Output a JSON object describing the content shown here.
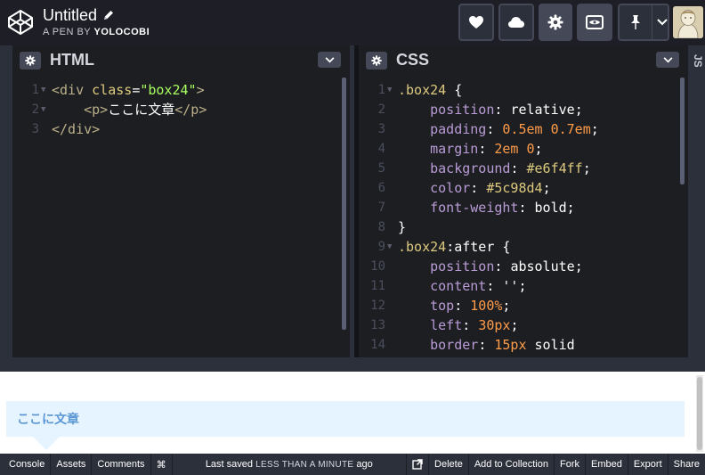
{
  "app": {
    "pen_title": "Untitled",
    "byline_prefix": "A PEN BY",
    "author": "YOLOCOBI"
  },
  "editors": {
    "html": {
      "title": "HTML",
      "lines": [
        {
          "num": "1",
          "fold": true
        },
        {
          "num": "2",
          "fold": true
        },
        {
          "num": "3",
          "fold": false
        }
      ],
      "code": {
        "l1_open": "<div",
        "l1_attr": " class",
        "l1_eq": "=",
        "l1_str": "\"box24\"",
        "l1_close": ">",
        "l2_indent": "    ",
        "l2_p_open": "<p>",
        "l2_text": "ここに文章",
        "l2_p_close": "</p>",
        "l3_close": "</div>"
      }
    },
    "css": {
      "title": "CSS",
      "line_numbers": [
        "1",
        "2",
        "3",
        "4",
        "5",
        "6",
        "7",
        "8",
        "9",
        "10",
        "11",
        "12",
        "13",
        "14"
      ],
      "code": {
        "l1_sel": ".box24",
        "l1_brace": " {",
        "l2_prop": "position",
        "l2_val": "relative",
        "l3_prop": "padding",
        "l3_val1": "0.5em",
        "l3_val2": "0.7em",
        "l4_prop": "margin",
        "l4_val1": "2em",
        "l4_val2": "0",
        "l5_prop": "background",
        "l5_val": "#e6f4ff",
        "l6_prop": "color",
        "l6_val": "#5c98d4",
        "l7_prop": "font-weight",
        "l7_val": "bold",
        "l8_brace": "}",
        "l9_sel": ".box24",
        "l9_pseudo": ":after",
        "l9_brace": " {",
        "l10_prop": "position",
        "l10_val": "absolute",
        "l11_prop": "content",
        "l11_val": "''",
        "l12_prop": "top",
        "l12_val": "100%",
        "l13_prop": "left",
        "l13_val": "30px",
        "l14_prop": "border",
        "l14_val1": "15px",
        "l14_val2": "solid"
      }
    },
    "js": {
      "title": "JS"
    }
  },
  "preview": {
    "box_text": "ここに文章",
    "box_bg": "#e6f4ff",
    "box_color": "#5c98d4"
  },
  "footer": {
    "console": "Console",
    "assets": "Assets",
    "comments": "Comments",
    "shortcut_icon": "⌘",
    "status_prefix": "Last saved",
    "status_caps": "LESS THAN A MINUTE",
    "status_suffix": "ago",
    "delete": "Delete",
    "add_to_collection": "Add to Collection",
    "fork": "Fork",
    "embed": "Embed",
    "export": "Export",
    "share": "Share"
  },
  "icons": {
    "logo": "codepen-logo-icon",
    "edit": "pencil-icon",
    "love": "heart-icon",
    "save": "cloud-icon",
    "settings": "gear-icon",
    "view": "eye-icon",
    "pin": "pin-icon",
    "menu": "chevron-down-icon",
    "external": "external-link-icon"
  },
  "colors": {
    "header_bg": "#1e1f26",
    "editor_bg": "#1d1e22",
    "panel_border": "#2c303a",
    "button_bg": "#444857"
  }
}
